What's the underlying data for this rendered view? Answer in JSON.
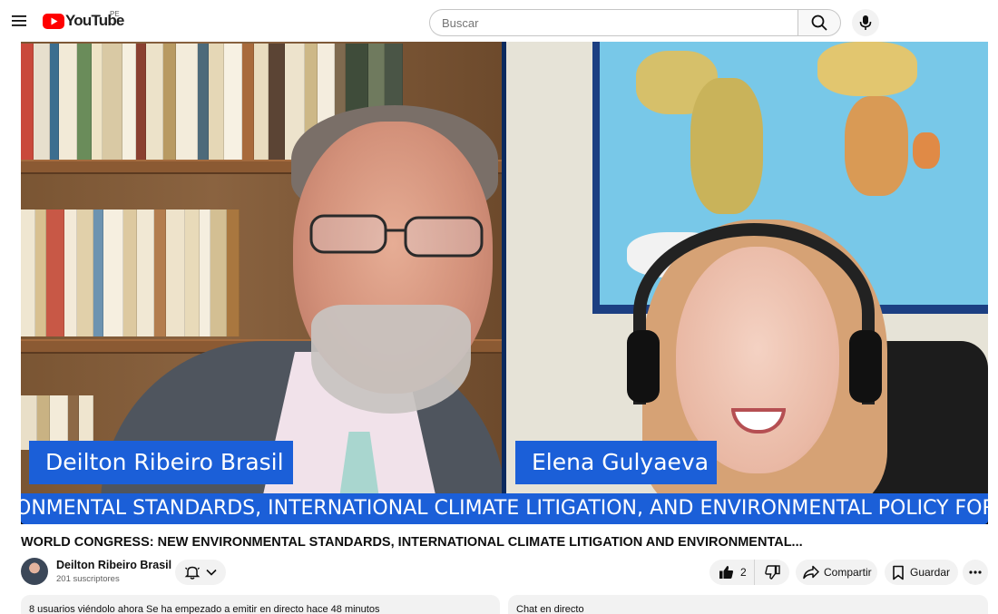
{
  "header": {
    "logo_text": "YouTube",
    "country_code": "PE",
    "search_placeholder": "Buscar",
    "icons": [
      "menu-icon",
      "search-icon",
      "mic-icon"
    ]
  },
  "video": {
    "speakers": [
      {
        "name": "Deilton Ribeiro Brasil"
      },
      {
        "name": "Elena Gulyaeva"
      }
    ],
    "ticker": "ONMENTAL STANDARDS, INTERNATIONAL CLIMATE LITIGATION, AND ENVIRONMENTAL POLICY FOR SI",
    "title": "WORLD CONGRESS: NEW ENVIRONMENTAL STANDARDS, INTERNATIONAL CLIMATE LITIGATION AND ENVIRONMENTAL..."
  },
  "channel": {
    "name": "Deilton Ribeiro Brasil",
    "subscribers": "201 suscriptores"
  },
  "actions": {
    "like_count": "2",
    "share_label": "Compartir",
    "save_label": "Guardar"
  },
  "description": {
    "status": "8 usuarios viéndolo ahora  Se ha empezado a emitir en directo hace 48 minutos"
  },
  "chat": {
    "title": "Chat en directo"
  },
  "colors": {
    "brand_red": "#ff0000",
    "banner_blue": "#1b5fd8"
  }
}
